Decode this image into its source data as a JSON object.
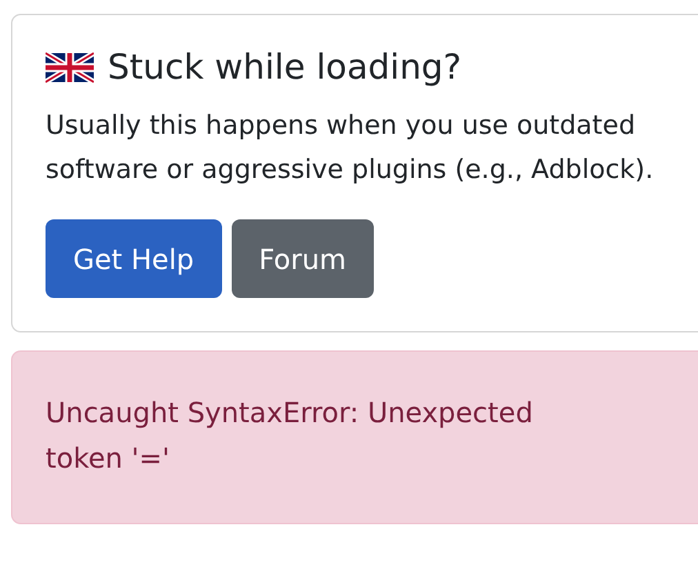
{
  "card": {
    "title": "Stuck while loading?",
    "message": "Usually this happens when you use outdated software or aggressive plugins (e.g., Adblock).",
    "buttons": [
      {
        "label": "Get Help",
        "kind": "primary"
      },
      {
        "label": "Forum",
        "kind": "secondary"
      }
    ]
  },
  "alert": {
    "kind": "danger",
    "text": "Uncaught SyntaxError: Unexpected token '='"
  }
}
